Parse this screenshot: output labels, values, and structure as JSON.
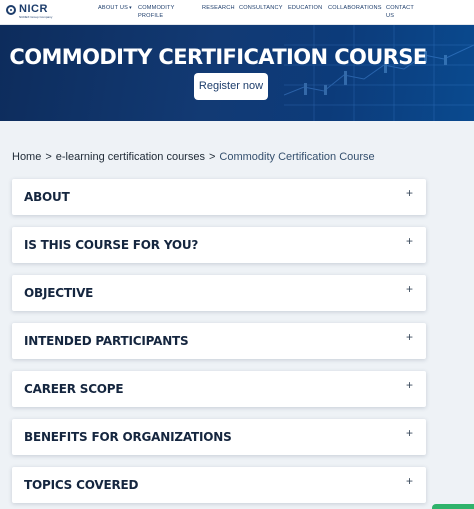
{
  "logo": {
    "name": "NICR",
    "tagline": "NCDEX Group Company"
  },
  "nav": [
    {
      "label": "ABOUT US",
      "caret": "▾"
    },
    {
      "label": "COMMODITY PROFILE"
    },
    {
      "label": "RESEARCH"
    },
    {
      "label": "CONSULTANCY"
    },
    {
      "label": "EDUCATION"
    },
    {
      "label": "COLLABORATIONS"
    },
    {
      "label": "CONTACT US"
    }
  ],
  "hero": {
    "title": "COMMODITY CERTIFICATION COURSE",
    "register_label": "Register now"
  },
  "breadcrumb": {
    "home": "Home",
    "section": "e-learning certification courses",
    "current": "Commodity Certification Course",
    "separator": ">"
  },
  "accordion": [
    {
      "title": "ABOUT",
      "icon": "+"
    },
    {
      "title": "IS THIS COURSE FOR YOU?",
      "icon": "+"
    },
    {
      "title": "OBJECTIVE",
      "icon": "+"
    },
    {
      "title": "INTENDED PARTICIPANTS",
      "icon": "+"
    },
    {
      "title": "CAREER SCOPE",
      "icon": "+"
    },
    {
      "title": "BENEFITS FOR ORGANIZATIONS",
      "icon": "+"
    },
    {
      "title": "TOPICS COVERED",
      "icon": "+"
    }
  ],
  "colors": {
    "brand": "#1d3d6b",
    "hero_bg": "#123a74",
    "accent_green": "#2fb36b"
  }
}
